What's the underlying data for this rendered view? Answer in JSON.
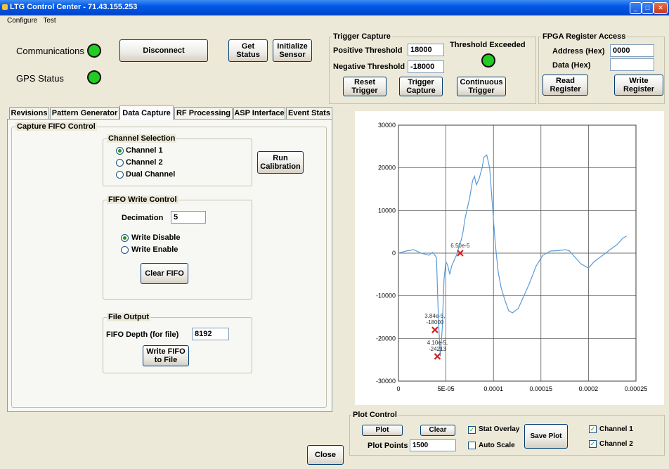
{
  "window": {
    "title": "LTG Control Center - 71.43.155.253"
  },
  "menu": [
    "Configure",
    "Test"
  ],
  "status": {
    "communications_label": "Communications",
    "gps_label": "GPS Status",
    "disconnect": "Disconnect",
    "get_status": "Get Status",
    "initialize_sensor": "Initialize Sensor"
  },
  "trigger": {
    "title": "Trigger Capture",
    "positive_label": "Positive Threshold",
    "positive_value": "18000",
    "negative_label": "Negative Threshold",
    "negative_value": "-18000",
    "exceeded_label": "Threshold Exceeded",
    "reset": "Reset Trigger",
    "capture": "Trigger Capture",
    "continuous": "Continuous Trigger"
  },
  "fpga": {
    "title": "FPGA Register Access",
    "address_label": "Address (Hex)",
    "address_value": "0000",
    "data_label": "Data (Hex)",
    "data_value": "",
    "read": "Read Register",
    "write": "Write Register"
  },
  "tabs": [
    "Revisions",
    "Pattern Generator",
    "Data Capture",
    "RF Processing",
    "ASP Interface",
    "Event Stats"
  ],
  "capture": {
    "title": "Capture FIFO Control",
    "channel_title": "Channel Selection",
    "channel_options": [
      "Channel 1",
      "Channel 2",
      "Dual Channel"
    ],
    "run_calibration": "Run Calibration",
    "fifo_title": "FIFO Write Control",
    "decimation_label": "Decimation",
    "decimation_value": "5",
    "write_options": [
      "Write Disable",
      "Write Enable"
    ],
    "clear_fifo": "Clear FIFO",
    "file_title": "File Output",
    "depth_label": "FIFO Depth (for file)",
    "depth_value": "8192",
    "write_fifo": "Write FIFO to File"
  },
  "close": "Close",
  "plot_control": {
    "title": "Plot Control",
    "plot": "Plot",
    "clear": "Clear",
    "stat_overlay": "Stat Overlay",
    "auto_scale": "Auto Scale",
    "save_plot": "Save Plot",
    "plot_points_label": "Plot Points",
    "plot_points_value": "1500",
    "channel1": "Channel 1",
    "channel2": "Channel 2"
  },
  "chart_data": {
    "type": "line",
    "title": "",
    "xlabel": "",
    "ylabel": "",
    "xlim": [
      0,
      0.00025
    ],
    "ylim": [
      -30000,
      30000
    ],
    "x_ticks": [
      0,
      5e-05,
      0.0001,
      0.00015,
      0.0002,
      0.00025
    ],
    "x_tick_labels": [
      "0",
      "5E-05",
      "0.0001",
      "0.00015",
      "0.0002",
      "0.00025"
    ],
    "y_ticks": [
      -30000,
      -20000,
      -10000,
      0,
      10000,
      20000,
      30000
    ],
    "y_tick_labels": [
      "-30000",
      "-20000",
      "-10000",
      "0",
      "10000",
      "20000",
      "30000"
    ],
    "grid": true,
    "series_color": "#5b9bd5",
    "marker_color": "#d42020",
    "series": [
      {
        "x": [
          0,
          8e-06,
          1.6e-05,
          2.4e-05,
          3.2e-05,
          3.6e-05,
          4e-05,
          4.2e-05,
          4.4e-05,
          4.6e-05,
          4.8e-05,
          5e-05,
          5.2e-05,
          5.4e-05,
          5.6e-05,
          5.8e-05,
          6e-05,
          6.2e-05,
          6.4e-05,
          6.6e-05,
          6.8e-05,
          7e-05,
          7.2e-05,
          7.5e-05,
          7.8e-05,
          8e-05,
          8.2e-05,
          8.5e-05,
          8.8e-05,
          9e-05,
          9.3e-05,
          9.6e-05,
          9.9e-05,
          0.000102,
          0.000105,
          0.000108,
          0.000112,
          0.000116,
          0.00012,
          0.000126,
          0.000132,
          0.000138,
          0.000145,
          0.000152,
          0.00016,
          0.000168,
          0.000176,
          0.00018,
          0.000186,
          0.000192,
          0.0002,
          0.000206,
          0.000212,
          0.000218,
          0.000224,
          0.00023,
          0.000236,
          0.00024
        ],
        "y": [
          0,
          500,
          800,
          0,
          -500,
          200,
          -1000,
          -15000,
          -24213,
          -18000,
          -6000,
          -2000,
          -3000,
          -5000,
          -3000,
          -2000,
          -1000,
          0,
          2000,
          3000,
          5000,
          8000,
          10000,
          13000,
          17000,
          18000,
          16000,
          17500,
          20000,
          22500,
          23000,
          20000,
          11000,
          2000,
          -4500,
          -8000,
          -11000,
          -13500,
          -14000,
          -13000,
          -10000,
          -7000,
          -3000,
          -500,
          500,
          600,
          800,
          500,
          -1000,
          -2500,
          -3500,
          -2000,
          -1000,
          0,
          1000,
          2000,
          3500,
          4000
        ]
      }
    ],
    "annotations": [
      {
        "x": 6.5e-05,
        "y": 0,
        "label": "6.50e-5"
      },
      {
        "x": 3.84e-05,
        "y": -18000,
        "label": "3.84e-5,\n-18000"
      },
      {
        "x": 4.1e-05,
        "y": -24213,
        "label": "4.10e-5,\n-24213"
      }
    ]
  }
}
